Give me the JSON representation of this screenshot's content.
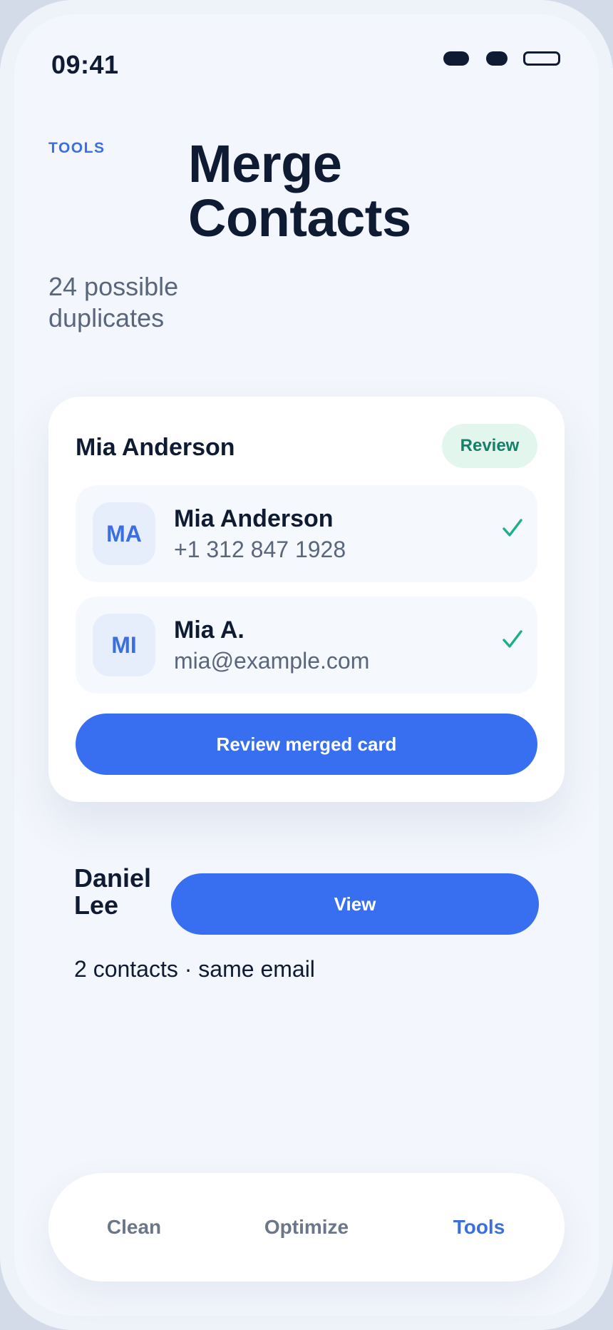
{
  "status_bar": {
    "time": "09:41"
  },
  "header": {
    "eyebrow": "TOOLS",
    "title": "Merge Contacts",
    "subtitle": "24 possible duplicates"
  },
  "group_card": {
    "name": "Mia Anderson",
    "badge": "Review",
    "contacts": [
      {
        "initials": "MA",
        "name": "Mia Anderson",
        "detail": "+1 312 847 1928"
      },
      {
        "initials": "MI",
        "name": "Mia A.",
        "detail": "mia@example.com"
      }
    ],
    "action_label": "Review merged card"
  },
  "second_group": {
    "name": "Daniel Lee",
    "action_label": "View",
    "detail": "2 contacts · same email"
  },
  "tab_bar": {
    "tabs": [
      {
        "label": "Clean",
        "active": false
      },
      {
        "label": "Optimize",
        "active": false
      },
      {
        "label": "Tools",
        "active": true
      }
    ]
  },
  "colors": {
    "accent": "#386ff0",
    "success": "#17806a",
    "text": "#0f1a33",
    "muted": "#5a667c"
  }
}
